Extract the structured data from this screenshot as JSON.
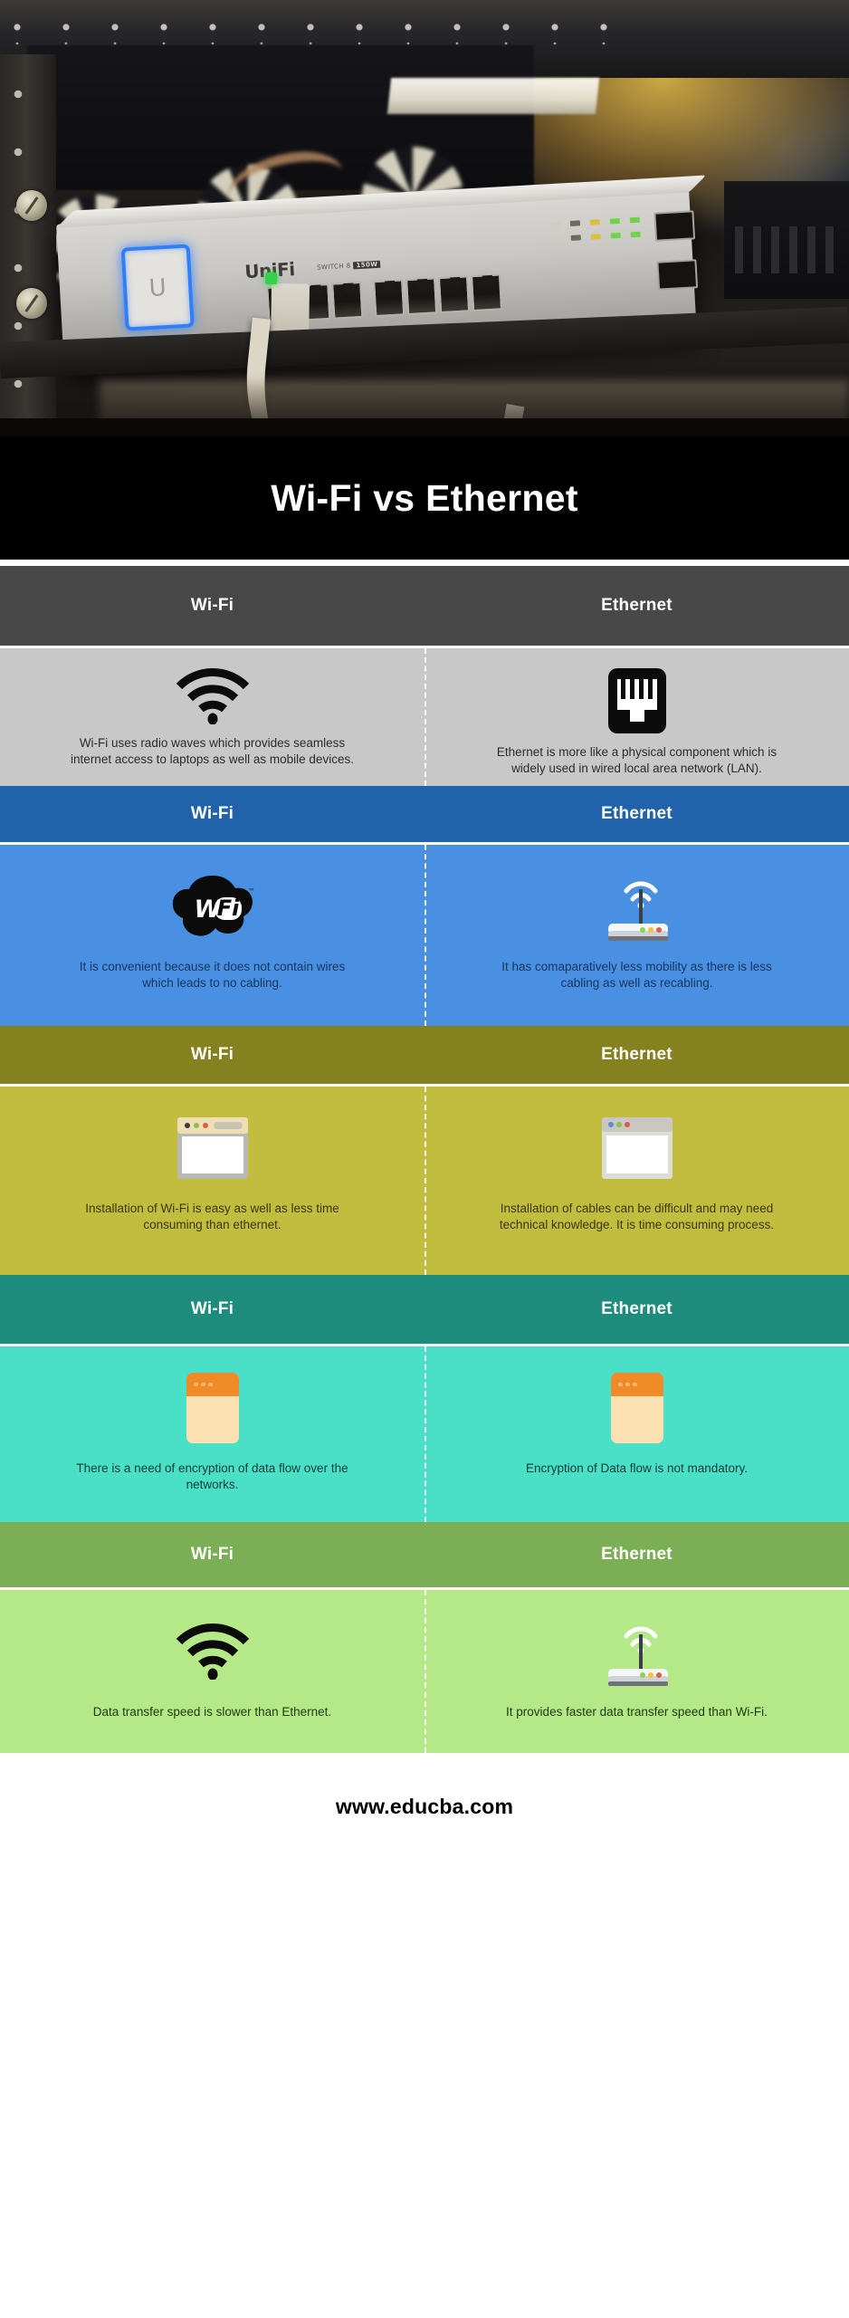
{
  "hero": {
    "alt": "Rack-mounted UniFi ethernet switch with cable plugged in",
    "device_brand": "UniFi",
    "device_model": "SWITCH 8",
    "device_model_badge": "150W",
    "led_letter": "U"
  },
  "title": "Wi-Fi vs Ethernet",
  "columns": {
    "left_label": "Wi-Fi",
    "right_label": "Ethernet"
  },
  "sections": [
    {
      "id": "definition",
      "theme": "gray",
      "header_bg": "#484848",
      "body_bg": "#c8c8c8",
      "left": {
        "label": "Wi-Fi",
        "icon": "wifi-signal-icon",
        "text": "Wi-Fi uses radio waves which provides seamless internet access to laptops as well as mobile devices."
      },
      "right": {
        "label": "Ethernet",
        "icon": "rj45-port-icon",
        "text": "Ethernet is more like a physical component which is widely used in wired local area network (LAN)."
      }
    },
    {
      "id": "convenience",
      "theme": "blue",
      "header_bg": "#2063ab",
      "body_bg": "#4a90e2",
      "left": {
        "label": "Wi-Fi",
        "icon": "wifi-logo-icon",
        "text": "It is convenient because it does not contain wires which leads to no cabling."
      },
      "right": {
        "label": "Ethernet",
        "icon": "wireless-router-icon",
        "text": "It has comaparatively less mobility as there is less cabling as well as recabling."
      }
    },
    {
      "id": "installation",
      "theme": "olive",
      "header_bg": "#85811f",
      "body_bg": "#c3bd3f",
      "left": {
        "label": "Wi-Fi",
        "icon": "browser-window-icon",
        "text": "Installation of Wi-Fi is easy as well as less time consuming than ethernet."
      },
      "right": {
        "label": "Ethernet",
        "icon": "browser-window-icon",
        "text": "Installation of cables can be difficult and may need technical knowledge. It is time consuming process."
      }
    },
    {
      "id": "encryption",
      "theme": "teal",
      "header_bg": "#1e8c7d",
      "body_bg": "#4ae0c8",
      "left": {
        "label": "Wi-Fi",
        "icon": "note-card-icon",
        "text": "There is a need of encryption of data flow over the networks."
      },
      "right": {
        "label": "Ethernet",
        "icon": "note-card-icon",
        "text": "Encryption of Data flow is not mandatory."
      }
    },
    {
      "id": "speed",
      "theme": "green",
      "header_bg": "#7cae55",
      "body_bg": "#b5e887",
      "left": {
        "label": "Wi-Fi",
        "icon": "wifi-signal-icon",
        "text": "Data transfer speed is slower than Ethernet."
      },
      "right": {
        "label": "Ethernet",
        "icon": "wireless-router-icon",
        "text": "It provides faster data transfer speed than Wi-Fi."
      }
    }
  ],
  "footer": {
    "website": "www.educba.com"
  }
}
